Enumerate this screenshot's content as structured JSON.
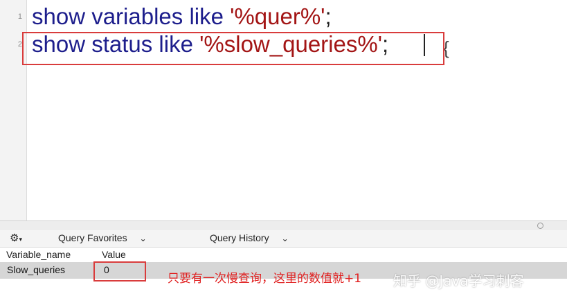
{
  "editor": {
    "line_numbers": [
      "1",
      "2"
    ],
    "line1": {
      "kw": "show variables like ",
      "str": "'%quer%'",
      "end": ";"
    },
    "line2": {
      "kw": "show status like ",
      "str": "'%slow_queries%'",
      "end": ";"
    },
    "extra_brace": "{"
  },
  "toolbar": {
    "gear_icon": "gear-icon",
    "gear_caret": "▾"
  },
  "tabs": [
    {
      "label": "Query Favorites",
      "chevron": "⌄"
    },
    {
      "label": "Query History",
      "chevron": "⌄"
    }
  ],
  "table": {
    "columns": [
      "Variable_name",
      "Value"
    ],
    "rows": [
      {
        "variable_name": "Slow_queries",
        "value": "0"
      }
    ]
  },
  "annotation": "只要有一次慢查询，这里的数值就+1",
  "watermark": "知乎 @Java学习刺客",
  "colors": {
    "keyword": "#1d1e8c",
    "string": "#a31515",
    "highlight_box": "#d93c3c",
    "annotation": "#e02020",
    "selected_row": "#d6d6d6"
  }
}
